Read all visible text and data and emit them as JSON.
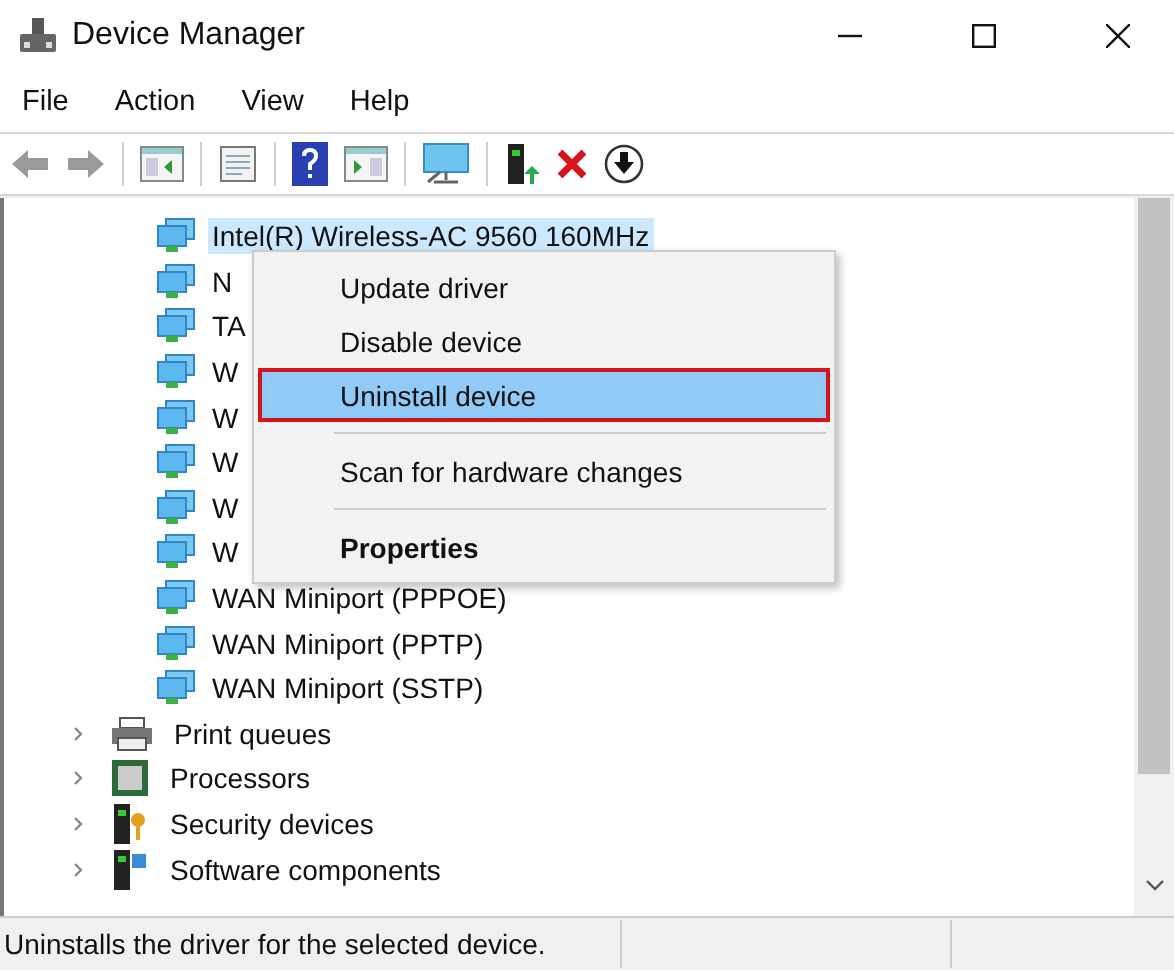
{
  "window": {
    "title": "Device Manager"
  },
  "menu": [
    "File",
    "Action",
    "View",
    "Help"
  ],
  "toolbar": [
    {
      "kind": "back",
      "disabled": true
    },
    {
      "kind": "forward",
      "disabled": true
    },
    {
      "kind": "sep"
    },
    {
      "kind": "console"
    },
    {
      "kind": "sep"
    },
    {
      "kind": "properties"
    },
    {
      "kind": "sep"
    },
    {
      "kind": "help"
    },
    {
      "kind": "pane"
    },
    {
      "kind": "sep"
    },
    {
      "kind": "monitor"
    },
    {
      "kind": "sep"
    },
    {
      "kind": "update"
    },
    {
      "kind": "remove"
    },
    {
      "kind": "download"
    }
  ],
  "tree": {
    "child_rows": [
      {
        "label": "Intel(R) Wireless-AC 9560 160MHz",
        "selected": true
      },
      {
        "label": "N",
        "selected": false
      },
      {
        "label": "TA",
        "selected": false
      },
      {
        "label": "W",
        "selected": false
      },
      {
        "label": "W",
        "selected": false
      },
      {
        "label": "W",
        "selected": false
      },
      {
        "label": "W",
        "selected": false
      },
      {
        "label": "W",
        "selected": false
      },
      {
        "label": "WAN Miniport (PPPOE)",
        "selected": false
      },
      {
        "label": "WAN Miniport (PPTP)",
        "selected": false
      },
      {
        "label": "WAN Miniport (SSTP)",
        "selected": false
      }
    ],
    "categories": [
      {
        "label": "Print queues",
        "kind": "printer",
        "expanded": false
      },
      {
        "label": "Processors",
        "kind": "processor",
        "expanded": false
      },
      {
        "label": "Security devices",
        "kind": "security",
        "expanded": false
      },
      {
        "label": "Software components",
        "kind": "component",
        "expanded": false
      }
    ]
  },
  "context_menu": {
    "items": [
      {
        "kind": "item",
        "label": "Update driver",
        "selected": false,
        "bold": false,
        "outlined": false
      },
      {
        "kind": "item",
        "label": "Disable device",
        "selected": false,
        "bold": false,
        "outlined": false
      },
      {
        "kind": "item",
        "label": "Uninstall device",
        "selected": true,
        "bold": false,
        "outlined": true
      },
      {
        "kind": "separator"
      },
      {
        "kind": "item",
        "label": "Scan for hardware changes",
        "selected": false,
        "bold": false,
        "outlined": false
      },
      {
        "kind": "separator"
      },
      {
        "kind": "item",
        "label": "Properties",
        "selected": false,
        "bold": true,
        "outlined": false
      }
    ]
  },
  "status_bar": {
    "text": "Uninstalls the driver for the selected device."
  }
}
